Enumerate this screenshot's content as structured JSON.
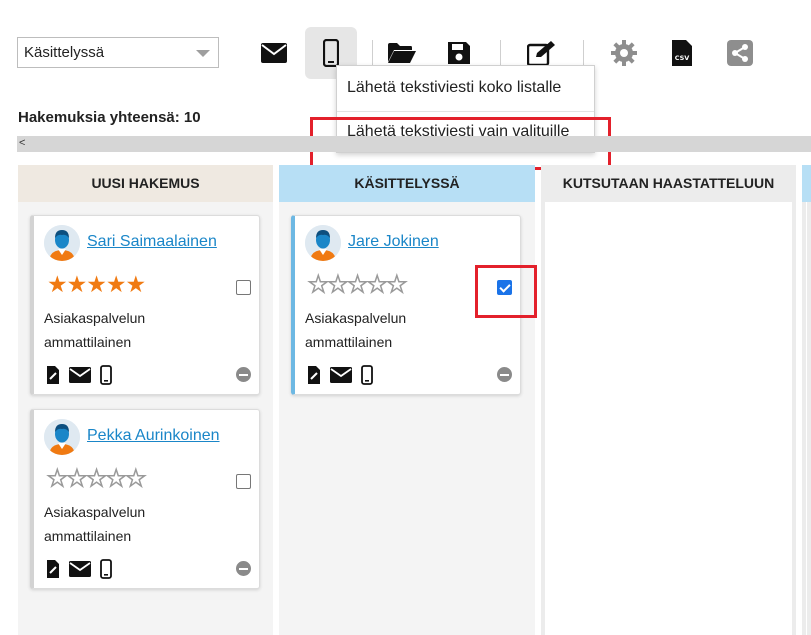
{
  "toolbar": {
    "status_value": "Käsittelyssä",
    "buttons": [
      "envelope-icon",
      "mobile-icon",
      "folder-open-icon",
      "save-icon",
      "edit-icon",
      "gear-icon",
      "csv-icon",
      "share-icon"
    ]
  },
  "sms_menu": {
    "item_all": "Lähetä tekstiviesti koko listalle",
    "item_selected": "Lähetä tekstiviesti vain valituille"
  },
  "summary": {
    "total_label": "Hakemuksia yhteensä: 10"
  },
  "scroll": {
    "left_arrow": "<"
  },
  "columns": [
    {
      "title": "UUSI HAKEMUS"
    },
    {
      "title": "KÄSITTELYSSÄ"
    },
    {
      "title": "KUTSUTAAN HAASTATTELUUN"
    },
    {
      "title": ""
    }
  ],
  "cards": [
    {
      "name": "Sari Saimaalainen",
      "rating": 5,
      "max_rating": 5,
      "role_line1": "Asiakaspalvelun",
      "role_line2": "ammattilainen",
      "checked": false
    },
    {
      "name": "Pekka Aurinkoinen",
      "rating": 0,
      "max_rating": 5,
      "role_line1": "Asiakaspalvelun",
      "role_line2": "ammattilainen",
      "checked": false
    },
    {
      "name": "Jare Jokinen",
      "rating": 0,
      "max_rating": 5,
      "role_line1": "Asiakaspalvelun",
      "role_line2": "ammattilainen",
      "checked": true
    }
  ],
  "colors": {
    "highlight": "#e3202b",
    "link": "#1a86c8",
    "star": "#f07a12",
    "checkbox": "#1a73e8"
  }
}
